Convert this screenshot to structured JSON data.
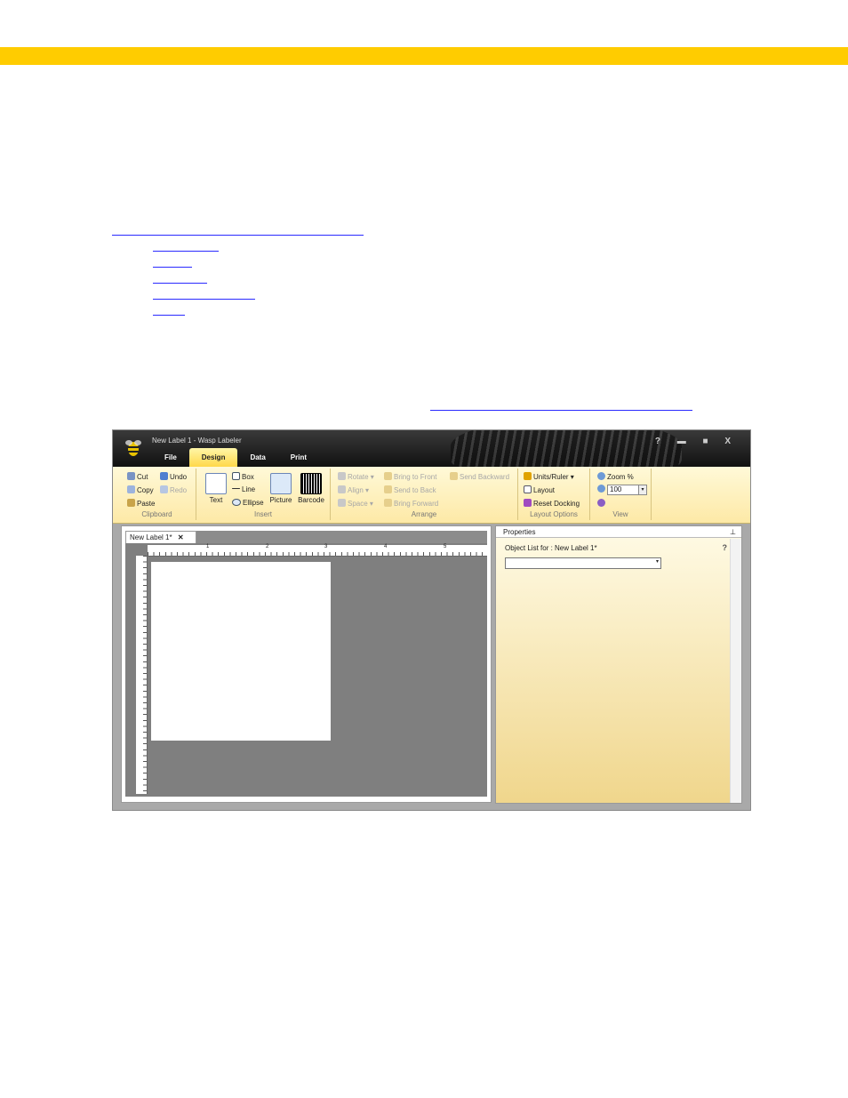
{
  "window": {
    "title": "New Label 1 - Wasp Labeler",
    "tabs": [
      "File",
      "Design",
      "Data",
      "Print"
    ],
    "active_tab": "Design",
    "controls": "? ▬ ■ X"
  },
  "ribbon": {
    "clipboard": {
      "cut": "Cut",
      "copy": "Copy",
      "paste": "Paste",
      "undo": "Undo",
      "redo": "Redo",
      "label": "Clipboard"
    },
    "insert": {
      "text": "Text",
      "box": "Box",
      "line": "Line",
      "ellipse": "Ellipse",
      "picture": "Picture",
      "barcode": "Barcode",
      "label": "Insert"
    },
    "arrange": {
      "rotate": "Rotate ▾",
      "align": "Align ▾",
      "space": "Space ▾",
      "bring_to_front": "Bring to Front",
      "send_to_back": "Send to Back",
      "bring_forward": "Bring Forward",
      "send_backward": "Send Backward",
      "label": "Arrange"
    },
    "layout_options": {
      "units_ruler": "Units/Ruler ▾",
      "layout": "Layout",
      "reset_docking": "Reset Docking",
      "label": "Layout Options"
    },
    "view": {
      "zoom": "Zoom %",
      "zoom_value": "100",
      "label": "View"
    }
  },
  "document": {
    "tab_label": "New Label 1*",
    "close": "✕",
    "ruler_h": [
      "1",
      "2",
      "3",
      "4",
      "5"
    ]
  },
  "properties": {
    "title": "Properties",
    "pin": "⊥",
    "object_list_label": "Object List for :  New Label 1*",
    "help": "?"
  },
  "colors": {
    "accent": "#ffcc00",
    "ribbon": "#fdeeb0",
    "link": "#2a2aff"
  }
}
